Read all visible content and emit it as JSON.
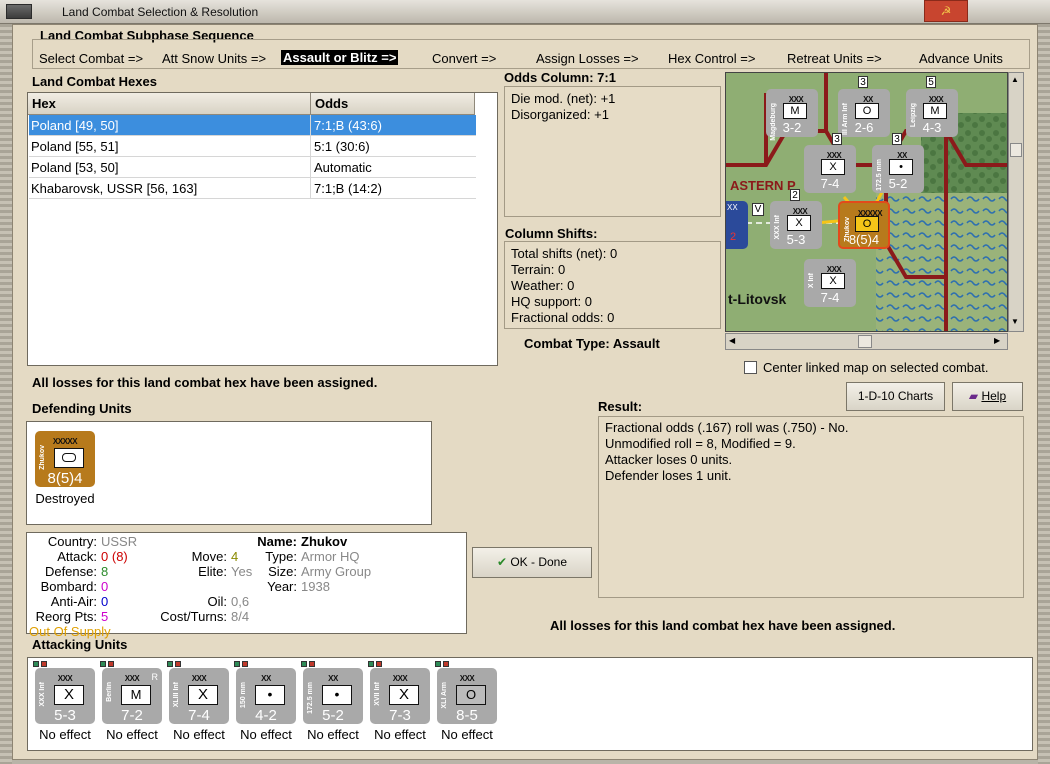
{
  "window": {
    "title": "Land Combat Selection & Resolution"
  },
  "subphase": {
    "label": "Land Combat Subphase Sequence",
    "steps": [
      {
        "label": "Select Combat =>",
        "active": false
      },
      {
        "label": "Att Snow Units =>",
        "active": false
      },
      {
        "label": "Assault or Blitz =>",
        "active": true
      },
      {
        "label": "Convert =>",
        "active": false
      },
      {
        "label": "Assign Losses =>",
        "active": false
      },
      {
        "label": "Hex Control =>",
        "active": false
      },
      {
        "label": "Retreat Units =>",
        "active": false
      },
      {
        "label": "Advance Units",
        "active": false
      }
    ]
  },
  "hexes": {
    "label": "Land Combat Hexes",
    "columns": [
      "Hex",
      "Odds"
    ],
    "rows": [
      {
        "hex": "Poland [49, 50]",
        "odds": "7:1;B (43:6)",
        "selected": true
      },
      {
        "hex": "Poland [55, 51]",
        "odds": "5:1 (30:6)",
        "selected": false
      },
      {
        "hex": "Poland [53, 50]",
        "odds": "Automatic",
        "selected": false
      },
      {
        "hex": "Khabarovsk, USSR [56, 163]",
        "odds": "7:1;B (14:2)",
        "selected": false
      }
    ]
  },
  "odds": {
    "label": "Odds Column: 7:1",
    "lines": [
      "Die mod. (net): +1",
      "Disorganized: +1"
    ]
  },
  "shifts": {
    "label": "Column Shifts:",
    "lines": [
      "Total shifts (net): 0",
      "Terrain: 0",
      "Weather: 0",
      "HQ support: 0",
      "Fractional odds: 0"
    ]
  },
  "combat_type": "Combat Type:  Assault",
  "map": {
    "labels": [
      "ASTERN P",
      "O",
      "t-Litovsk"
    ],
    "units": [
      {
        "name": "Magdeburg",
        "echelon": "XXX",
        "value": "3-2",
        "symbol": "M",
        "badge": "3"
      },
      {
        "name": "III Arm Inf",
        "echelon": "XX",
        "value": "2-6",
        "symbol": "O",
        "badge": ""
      },
      {
        "name": "Leipzig",
        "echelon": "XXX",
        "value": "4-3",
        "symbol": "M",
        "badge": "5"
      },
      {
        "name": "",
        "echelon": "XXX",
        "value": "7-4",
        "symbol": "X",
        "badge": "3"
      },
      {
        "name": "172.5 mm",
        "echelon": "XX",
        "value": "5-2",
        "symbol": "•",
        "badge": "3"
      },
      {
        "name": "XXX Inf",
        "echelon": "XXX",
        "value": "5-3",
        "symbol": "X",
        "badge": "2"
      },
      {
        "name": "Zhukov",
        "echelon": "XXXXX",
        "value": "8(5)4",
        "symbol": "O",
        "badge": ""
      },
      {
        "name": "X Inf",
        "echelon": "XXX",
        "value": "7-4",
        "symbol": "X",
        "badge": ""
      },
      {
        "name": "",
        "echelon": "XX",
        "value": "2",
        "symbol": "",
        "badge": "V"
      }
    ]
  },
  "center_map": {
    "label": "Center linked map on selected combat.",
    "checked": false
  },
  "buttons": {
    "charts": "1-D-10 Charts",
    "help": "Help",
    "ok": "OK - Done"
  },
  "losses_msg": "All losses for this land combat hex have been assigned.",
  "defending": {
    "label": "Defending Units",
    "units": [
      {
        "name": "Zhukov",
        "echelon": "XXXXX",
        "value": "8(5)4",
        "status": "Destroyed"
      }
    ]
  },
  "result": {
    "label": "Result:",
    "lines": [
      "Fractional odds (.167) roll was (.750)  - No.",
      "Unmodified roll = 8, Modified = 9.",
      "Attacker loses 0 units.",
      "Defender loses 1 unit."
    ]
  },
  "unit_info": {
    "country_k": "Country:",
    "country": "USSR",
    "attack_k": "Attack:",
    "attack": "0",
    "attack_paren": "(8)",
    "defense_k": "Defense:",
    "defense": "8",
    "bombard_k": "Bombard:",
    "bombard": "0",
    "antiair_k": "Anti-Air:",
    "antiair": "0",
    "reorg_k": "Reorg Pts:",
    "reorg": "5",
    "supply": "Out Of Supply",
    "move_k": "Move:",
    "move": "4",
    "elite_k": "Elite:",
    "elite": "Yes",
    "oil_k": "Oil:",
    "oil": "0,6",
    "cost_k": "Cost/Turns:",
    "cost": "8/4",
    "name_k": "Name:",
    "name": "Zhukov",
    "type_k": "Type:",
    "type": "Armor HQ",
    "size_k": "Size:",
    "size": "Army Group",
    "year_k": "Year:",
    "year": "1938"
  },
  "attacking": {
    "label": "Attacking Units",
    "units": [
      {
        "name": "XXX Inf",
        "echelon": "XXX",
        "value": "5-3",
        "symbol": "X",
        "tag": "",
        "status": "No effect"
      },
      {
        "name": "Berlin",
        "echelon": "XXX",
        "value": "7-2",
        "symbol": "M",
        "tag": "R",
        "status": "No effect"
      },
      {
        "name": "XLIII Inf",
        "echelon": "XXX",
        "value": "7-4",
        "symbol": "X",
        "tag": "",
        "status": "No effect"
      },
      {
        "name": "150 mm",
        "echelon": "XX",
        "value": "4-2",
        "symbol": "•",
        "tag": "",
        "status": "No effect"
      },
      {
        "name": "172.5 mm",
        "echelon": "XX",
        "value": "5-2",
        "symbol": "•",
        "tag": "",
        "status": "No effect"
      },
      {
        "name": "XVII Inf",
        "echelon": "XXX",
        "value": "7-3",
        "symbol": "X",
        "tag": "",
        "status": "No effect"
      },
      {
        "name": "XLI Arm",
        "echelon": "XXX",
        "value": "8-5",
        "symbol": "O",
        "tag": "",
        "status": "No effect"
      }
    ]
  },
  "colors": {
    "accent": "#3c8ede",
    "counter_grey": "#a9a9a9",
    "counter_soviet": "#b77a1c",
    "attack_red": "#cc0000",
    "defense_green": "#2a8a2a",
    "bombard_magenta": "#cc00cc",
    "antiair_blue": "#0000cc",
    "supply_orange": "#e0a000"
  }
}
